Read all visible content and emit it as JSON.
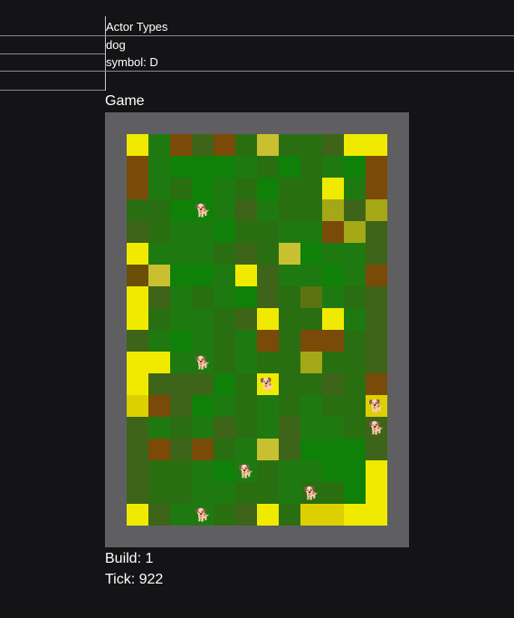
{
  "actor_types": {
    "heading": "Actor Types",
    "name": "dog",
    "symbol_line": "symbol: D"
  },
  "game": {
    "heading": "Game",
    "grid_cols": 12,
    "grid_rows": 18,
    "palette": {
      "Y": "#f0ea00",
      "y": "#dcd000",
      "o": "#c8c030",
      "l": "#a4a816",
      "b": "#7a4a08",
      "c": "#6a5006",
      "m": "#5b7410",
      "n": "#3d6418",
      "d": "#2a6e12",
      "g": "#1e7a10",
      "G": "#0f8008",
      "h": "#0a7608"
    },
    "tiles": [
      "YgbnbdoddnYY",
      "bgGGGgdGdgGb",
      "bgdGgdGddYgb",
      "ddGGgngddlnl",
      "ndggGddggbln",
      "YgggdndoGggn",
      "coGGgYnggGgb",
      "YngdgGndmgdn",
      "YdggdnYddYgn",
      "ngGgdgbdbbdn",
      "YYggdgddlddn",
      "YnnnGdYddndb",
      "ybnGgdgdgddy",
      "ngdgndgnggdn",
      "nbnbdgonGGGn",
      "nddgGgdggGGY",
      "nddggddgddGY",
      "YnggdnYdyyYY"
    ],
    "highlight_tile": {
      "col": 6,
      "row": 11,
      "color": "#f0ea00"
    },
    "dog_icon": "dog-emoji-icon",
    "dog_glyph": "🐕",
    "dogs": [
      {
        "col": 3,
        "row": 3
      },
      {
        "col": 3,
        "row": 10
      },
      {
        "col": 6,
        "row": 11
      },
      {
        "col": 11,
        "row": 12
      },
      {
        "col": 11,
        "row": 13
      },
      {
        "col": 5,
        "row": 15
      },
      {
        "col": 8,
        "row": 16
      },
      {
        "col": 3,
        "row": 17
      }
    ]
  },
  "status": {
    "build": "Build: 1",
    "tick": "Tick: 922"
  }
}
